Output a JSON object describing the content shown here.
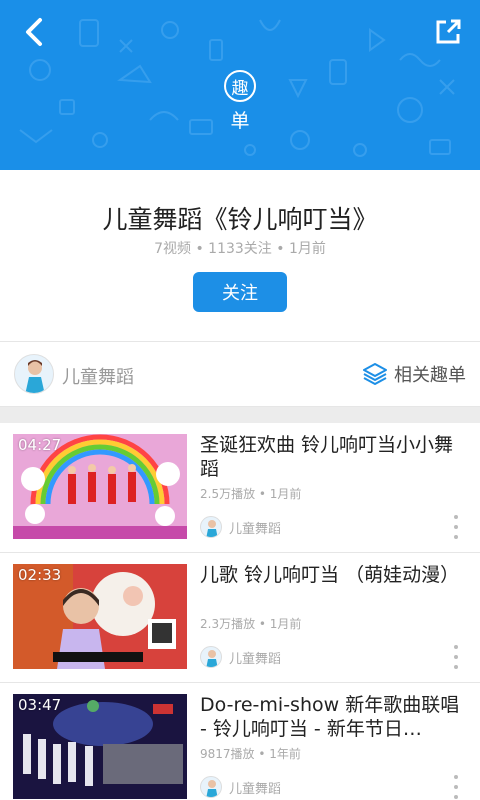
{
  "header": {
    "badge_text": "趣",
    "subtitle": "单",
    "bg_color": "#1a8fe8"
  },
  "playlist": {
    "title": "儿童舞蹈《铃儿响叮当》",
    "meta": "7视频 • 1133关注 • 1月前",
    "follow_label": "关注"
  },
  "owner": {
    "name": "儿童舞蹈",
    "related_label": "相关趣单"
  },
  "videos": [
    {
      "duration": "04:27",
      "title": "圣诞狂欢曲  铃儿响叮当小小舞蹈",
      "meta": "2.5万播放 • 1月前",
      "owner": "儿童舞蹈"
    },
    {
      "duration": "02:33",
      "title": "儿歌  铃儿响叮当  （萌娃动漫）",
      "meta": "2.3万播放 • 1月前",
      "owner": "儿童舞蹈"
    },
    {
      "duration": "03:47",
      "title": "Do-re-mi-show 新年歌曲联唱 - 铃儿响叮当 - 新年节日…",
      "meta": "9817播放 • 1年前",
      "owner": "儿童舞蹈"
    }
  ],
  "icons": {
    "back": "chevron-left-icon",
    "share": "share-external-icon",
    "related": "layers-icon",
    "more": "more-vertical-icon"
  }
}
